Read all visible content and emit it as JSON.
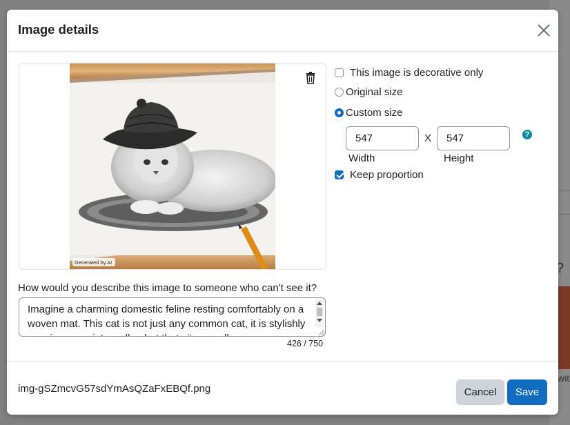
{
  "dialog": {
    "title": "Image details",
    "close_label": "close-icon"
  },
  "image": {
    "watermark": "Generated by AI",
    "delete_icon": "trash-icon"
  },
  "options": {
    "decorative_label": "This image is decorative only",
    "decorative_checked": false,
    "original_size_label": "Original size",
    "custom_size_label": "Custom size",
    "selected_size": "custom",
    "width_value": "547",
    "height_value": "547",
    "times_symbol": "X",
    "width_label": "Width",
    "height_label": "Height",
    "help_icon": "question-circle-icon",
    "keep_proportion_label": "Keep proportion",
    "keep_proportion_checked": true
  },
  "alt_text": {
    "question": "How would you describe this image to someone who can't see it?",
    "value": "Imagine a charming domestic feline resting comfortably on a woven mat. This cat is not just any common cat, it is stylishly wearing a quaint woollen hat that sits proudly",
    "counter": "426 / 750"
  },
  "footer": {
    "filename": "img-gSZmcvG57sdYmAsQZaFxEBQf.png",
    "cancel_label": "Cancel",
    "save_label": "Save"
  },
  "colors": {
    "primary": "#0f6cbf",
    "secondary": "#ced4da",
    "help": "#0c8c9a",
    "backdrop": "#808080"
  }
}
